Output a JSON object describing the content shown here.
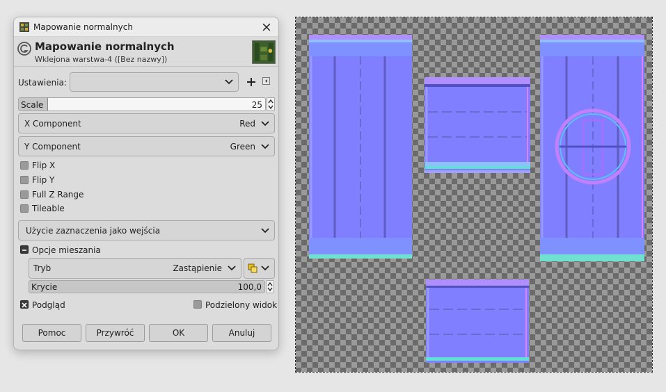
{
  "window": {
    "title": "Mapowanie normalnych",
    "icons": {
      "app": "gimp-wilber-icon",
      "close": "close-icon",
      "header": "gimp-filter-icon"
    }
  },
  "header": {
    "title": "Mapowanie normalnych",
    "subtitle": "Wklejona warstwa-4 ([Bez nazwy])"
  },
  "settings": {
    "label": "Ustawienia:",
    "value": "",
    "add_icon": "plus-icon",
    "menu_icon": "menu-arrow-icon"
  },
  "scale": {
    "label": "Scale",
    "value": "25",
    "fraction": 0.12
  },
  "x_component": {
    "label": "X Component",
    "value": "Red"
  },
  "y_component": {
    "label": "Y Component",
    "value": "Green"
  },
  "checkboxes": [
    {
      "label": "Flip X",
      "checked": false
    },
    {
      "label": "Flip Y",
      "checked": false
    },
    {
      "label": "Full Z Range",
      "checked": false
    },
    {
      "label": "Tileable",
      "checked": false
    }
  ],
  "input_selection": {
    "value": "Użycie zaznaczenia jako wejścia"
  },
  "blending": {
    "toggle_label": "Opcje mieszania",
    "expanded": true,
    "mode_label": "Tryb",
    "mode_value": "Zastąpienie",
    "opacity_label": "Krycie",
    "opacity_value": "100,0"
  },
  "preview": {
    "preview_label": "Podgląd",
    "preview_checked": true,
    "split_label": "Podzielony widok",
    "split_checked": false
  },
  "buttons": {
    "help": "Pomoc",
    "reset": "Przywróć",
    "ok": "OK",
    "cancel": "Anuluj"
  },
  "colors": {
    "normal_base": "#7f7fff",
    "checker_light": "#9a9a9a",
    "checker_dark": "#6a6a6a"
  }
}
